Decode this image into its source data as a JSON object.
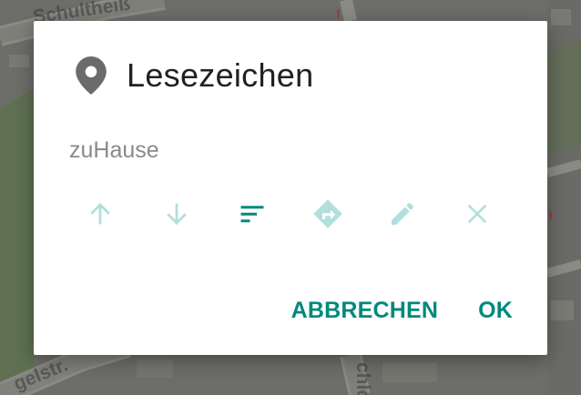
{
  "map": {
    "street_labels": [
      "Schultheiß",
      "gelstr.",
      "chlo"
    ]
  },
  "dialog": {
    "icon": "map-marker-icon",
    "title": "Lesezeichen",
    "bookmark_name": "zuHause",
    "actions": [
      {
        "name": "move-up",
        "icon": "arrow-up-icon",
        "enabled": false
      },
      {
        "name": "move-down",
        "icon": "arrow-down-icon",
        "enabled": false
      },
      {
        "name": "sort",
        "icon": "sort-icon",
        "enabled": true
      },
      {
        "name": "navigate",
        "icon": "directions-icon",
        "enabled": false
      },
      {
        "name": "edit",
        "icon": "pencil-icon",
        "enabled": false
      },
      {
        "name": "delete",
        "icon": "close-icon",
        "enabled": false
      }
    ],
    "cancel_label": "ABBRECHEN",
    "ok_label": "OK"
  },
  "colors": {
    "accent": "#00897b",
    "disabled_icon": "#b2dfdb",
    "title_text": "#212121",
    "secondary_text": "#8a8a8a",
    "dialog_background": "#ffffff"
  }
}
